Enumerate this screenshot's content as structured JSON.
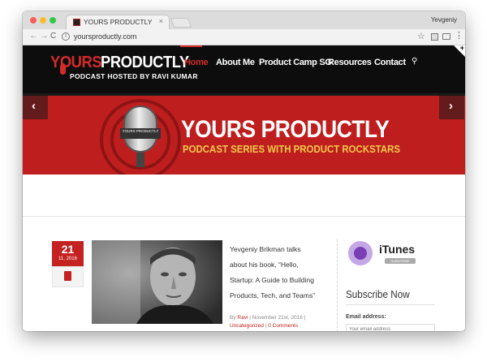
{
  "browser": {
    "tab_title": "YOURS PRODUCTLY",
    "tab_close": "×",
    "user": "Yevgeniy",
    "url": "yoursproductly.com",
    "back_glyph": "←",
    "forward_glyph": "→",
    "reload_glyph": "C",
    "info_glyph": "i",
    "star_glyph": "☆",
    "menu_glyph": "⋮",
    "traffic_lights": {
      "close": "#fc5f57",
      "minimize": "#fdbc2e",
      "zoom": "#34c84a"
    }
  },
  "site": {
    "logo": {
      "word1": "YOURS",
      "word2": "PRODUCTLY",
      "subtitle": "PODCAST HOSTED BY RAVI KUMAR"
    },
    "nav": [
      {
        "label": "Home",
        "active": true
      },
      {
        "label": "About Me",
        "active": false
      },
      {
        "label": "Product Camp SG",
        "active": false
      },
      {
        "label": "Resources",
        "active": false
      },
      {
        "label": "Contact",
        "active": false
      }
    ],
    "search_glyph": "⚲",
    "corner_glyph": "+",
    "accent_color": "#c42121",
    "banner": {
      "title": "YOURS PRODUCTLY",
      "subtitle": "PODCAST SERIES WITH PRODUCT ROCKSTARS",
      "mic_label": "YOURS PRODUCTLY",
      "prev_glyph": "‹",
      "next_glyph": "›"
    },
    "post": {
      "day": "21",
      "month_year": "11, 2016",
      "title": "Yevgeniy Brikman talks about his book, “Hello, Startup: A Guide to Building Products, Tech, and Teams”",
      "meta": {
        "by": "By",
        "author": "Ravi",
        "date": "November 21st, 2016",
        "category": "Uncategorized",
        "comments": "0 Comments"
      }
    },
    "sidebar": {
      "itunes_label": "iTunes",
      "itunes_button": "SUBSCRIBE",
      "subscribe_title": "Subscribe Now",
      "email_label": "Email address:",
      "email_placeholder": "Your email address"
    }
  }
}
